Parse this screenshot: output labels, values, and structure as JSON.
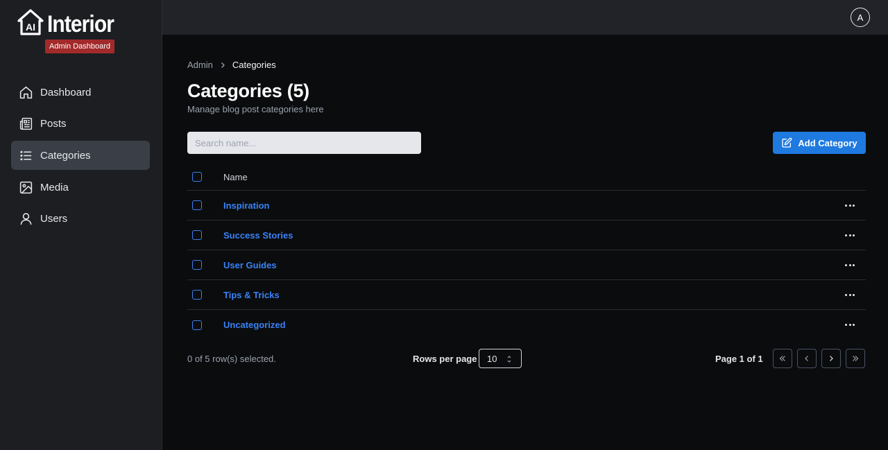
{
  "brand": {
    "logo_mark": "AI",
    "name": "Interior",
    "badge": "Admin Dashboard",
    "badge_color": "#a32a2a"
  },
  "sidebar": {
    "items": [
      {
        "label": "Dashboard",
        "icon": "home-icon",
        "active": false
      },
      {
        "label": "Posts",
        "icon": "newspaper-icon",
        "active": false
      },
      {
        "label": "Categories",
        "icon": "list-icon",
        "active": true
      },
      {
        "label": "Media",
        "icon": "image-icon",
        "active": false
      },
      {
        "label": "Users",
        "icon": "user-icon",
        "active": false
      }
    ]
  },
  "header": {
    "avatar_initial": "A"
  },
  "breadcrumb": {
    "parent": "Admin",
    "current": "Categories"
  },
  "page": {
    "title": "Categories (5)",
    "subtitle": "Manage blog post categories here"
  },
  "search": {
    "placeholder": "Search name...",
    "value": ""
  },
  "actions": {
    "add_label": "Add Category",
    "accent": "#1f7ae0"
  },
  "table": {
    "columns": [
      "Name"
    ],
    "rows": [
      {
        "name": "Inspiration"
      },
      {
        "name": "Success Stories"
      },
      {
        "name": "User Guides"
      },
      {
        "name": "Tips & Tricks"
      },
      {
        "name": "Uncategorized"
      }
    ]
  },
  "pagination": {
    "selected_text": "0 of 5 row(s) selected.",
    "rows_per_page_label": "Rows per page",
    "rows_per_page_value": "10",
    "page_text": "Page 1 of 1"
  }
}
